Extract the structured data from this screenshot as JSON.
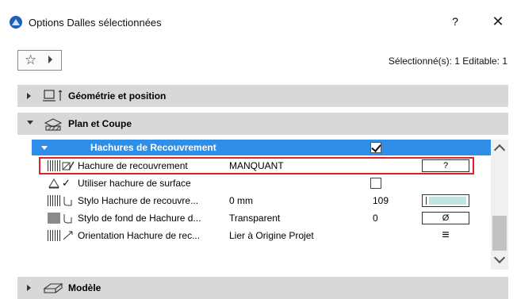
{
  "window": {
    "title": "Options Dalles sélectionnées",
    "help_label": "?",
    "close_label": "✕"
  },
  "toolbar": {
    "favorites_icon": "star-icon",
    "selection_info": "Sélectionné(s): 1 Editable: 1"
  },
  "sections": [
    {
      "label": "Géométrie et position",
      "expanded": false,
      "icon": "geometry-icon"
    },
    {
      "label": "Plan et Coupe",
      "expanded": true,
      "icon": "plan-section-icon"
    },
    {
      "label": "Modèle",
      "expanded": false,
      "icon": "model-icon"
    }
  ],
  "subsection": {
    "label": "Hachures de Recouvrement",
    "checked": true
  },
  "rows": [
    {
      "name": "Hachure de recouvrement",
      "value": "MANQUANT",
      "number": "",
      "control": "?"
    },
    {
      "name": "Utiliser hachure de surface",
      "value": "",
      "number": "",
      "control": ""
    },
    {
      "name": "Stylo Hachure de recouvre...",
      "value": "0 mm",
      "number": "109",
      "control": "",
      "pen_color": "#bfe6e2"
    },
    {
      "name": "Stylo de fond de Hachure d...",
      "value": "Transparent",
      "number": "0",
      "control": "Ø"
    },
    {
      "name": "Orientation Hachure de rec...",
      "value": "Lier à Origine Projet",
      "number": "",
      "control": "≡"
    }
  ],
  "colors": {
    "accent": "#2f8ee8",
    "highlight_border": "#e0202a",
    "section_bg": "#d8d8d8"
  }
}
